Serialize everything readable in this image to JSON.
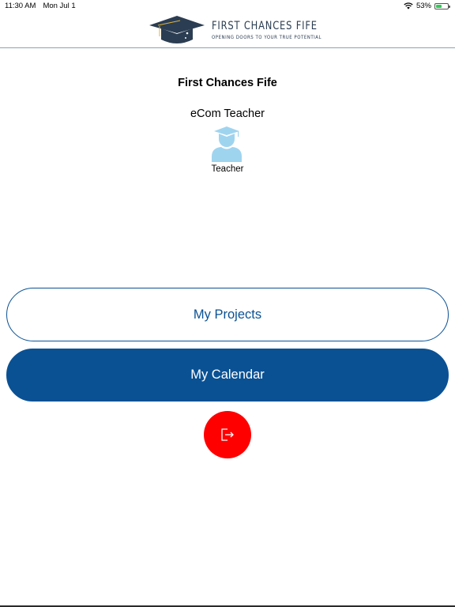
{
  "status_bar": {
    "time": "11:30 AM",
    "date": "Mon Jul 1",
    "battery_percent": "53%",
    "battery_level": 0.53,
    "icons": [
      "wifi-icon",
      "battery-icon"
    ]
  },
  "header": {
    "logo_title": "FIRST CHANCES FIFE",
    "logo_tagline": "OPENING DOORS TO YOUR TRUE POTENTIAL",
    "logo_icon": "graduation-cap-icon"
  },
  "profile": {
    "organization": "First Chances Fife",
    "user_name": "eCom Teacher",
    "role_icon": "teacher-avatar-icon",
    "role": "Teacher"
  },
  "actions": {
    "projects_label": "My Projects",
    "calendar_label": "My Calendar",
    "logout_icon": "logout-icon"
  },
  "colors": {
    "primary": "#0a5194",
    "logout": "#ff0000",
    "avatar": "#9fd4ef",
    "logo_navy": "#2b3d52"
  }
}
